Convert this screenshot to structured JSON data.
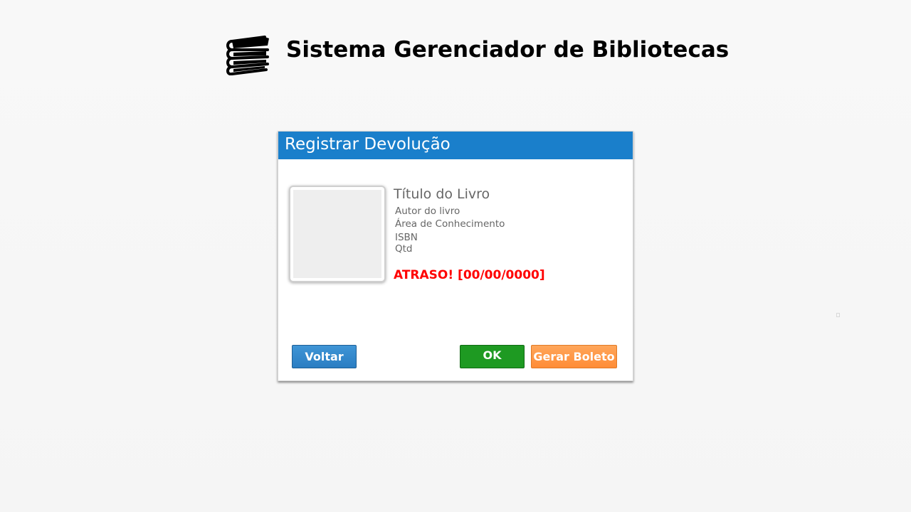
{
  "header": {
    "logo_icon": "books-stack-icon",
    "title": "Sistema Gerenciador de Bibliotecas"
  },
  "dialog": {
    "title": "Registrar Devolução",
    "header_color": "#1a7fcb",
    "book": {
      "cover_icon": "book-cover-placeholder",
      "title": "Título do Livro",
      "author": "Autor do livro",
      "area": "Área de Conhecimento",
      "isbn": "ISBN",
      "qtd": "Qtd"
    },
    "late_notice": "ATRASO! [00/00/0000]",
    "late_color": "#ff0000",
    "buttons": {
      "back_label": "Voltar",
      "ok_label": "OK",
      "boleto_label": "Gerar Boleto"
    },
    "button_colors": {
      "back": "#2a7dc2",
      "ok": "#1e9a22",
      "boleto": "#ff8c36"
    }
  }
}
